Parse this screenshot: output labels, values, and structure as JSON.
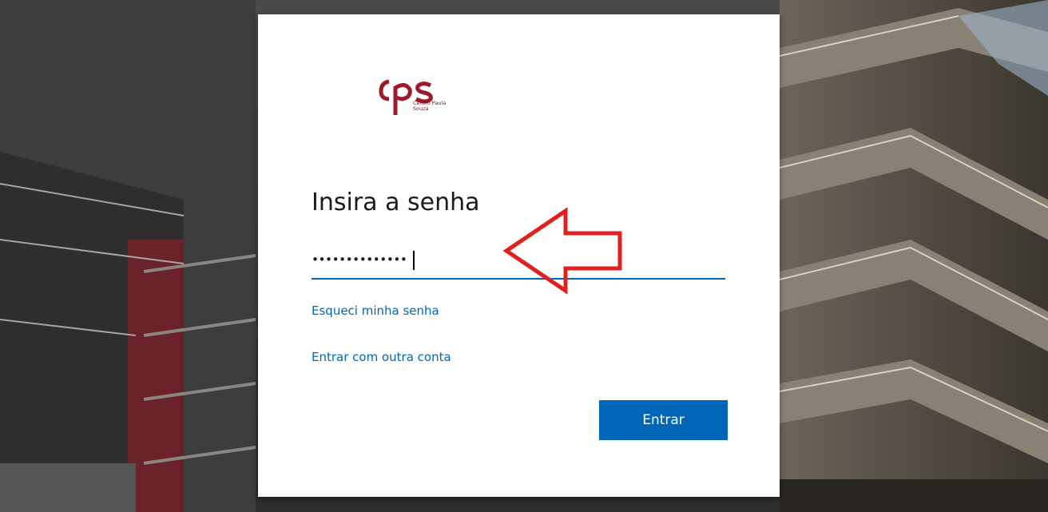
{
  "brand": {
    "logo_text": "cps",
    "logo_subtitle": "Centro Paula Souza",
    "brand_color": "#9b1b2a"
  },
  "login": {
    "heading": "Insira a senha",
    "password_value": "••••••••••••••",
    "forgot_password_link": "Esqueci minha senha",
    "other_account_link": "Entrar com outra conta",
    "submit_label": "Entrar",
    "accent_color": "#0067b8"
  },
  "annotation": {
    "arrow_icon": "left-arrow-outline-icon",
    "arrow_color": "#e0211d"
  }
}
